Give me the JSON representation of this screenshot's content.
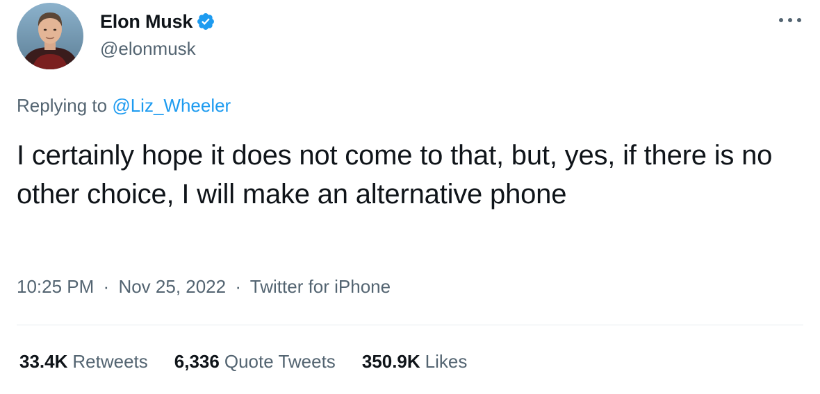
{
  "author": {
    "display_name": "Elon Musk",
    "handle": "@elonmusk",
    "verified_icon": "verified-badge-icon",
    "verified_color": "#1d9bf0"
  },
  "reply": {
    "prefix": "Replying to",
    "to_handle": "@Liz_Wheeler"
  },
  "tweet": {
    "text": "I certainly hope it does not come to that, but, yes, if there is no other choice, I will make an alternative phone"
  },
  "meta": {
    "time": "10:25 PM",
    "separator": "·",
    "date": "Nov 25, 2022",
    "source": "Twitter for iPhone"
  },
  "stats": {
    "retweets_count": "33.4K",
    "retweets_label": "Retweets",
    "quotes_count": "6,336",
    "quotes_label": "Quote Tweets",
    "likes_count": "350.9K",
    "likes_label": "Likes"
  },
  "icons": {
    "more": "more-options-icon"
  },
  "colors": {
    "link": "#1d9bf0",
    "text_primary": "#0f1419",
    "text_secondary": "#536471"
  }
}
